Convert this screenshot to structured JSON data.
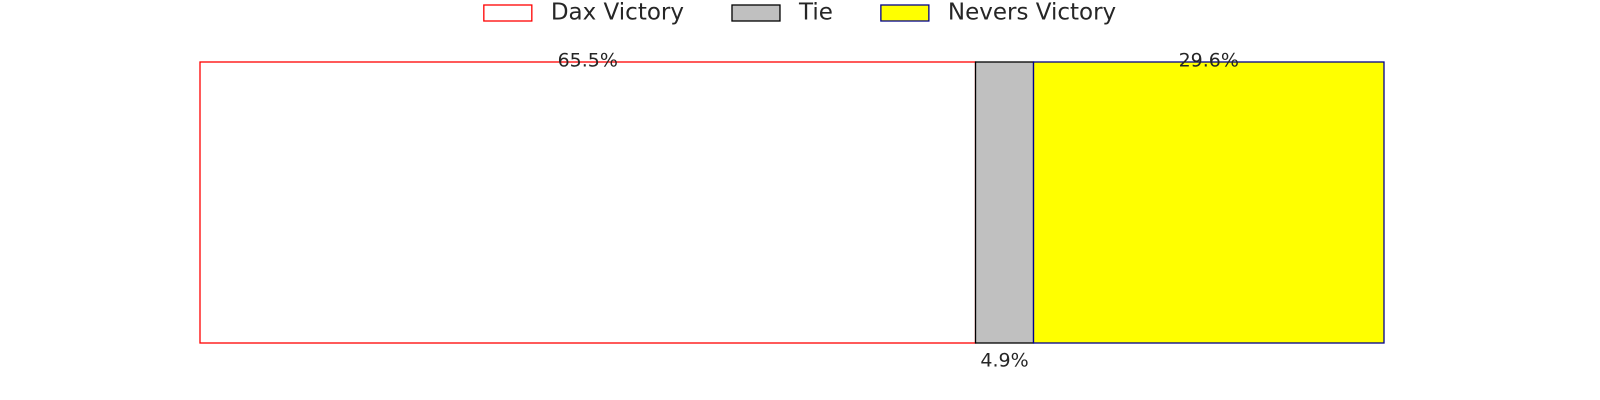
{
  "chart_data": {
    "type": "bar",
    "orientation": "horizontal",
    "stacked": true,
    "title": "",
    "xlabel": "",
    "ylabel": "",
    "grid": false,
    "legend_placement": "top-center",
    "xlim": [
      0,
      100
    ],
    "categories": [
      ""
    ],
    "series": [
      {
        "name": "Dax Victory",
        "values": [
          65.5
        ],
        "label": "65.5%",
        "label_position": "above",
        "fill": "#ffffff",
        "stroke": "#ff0000"
      },
      {
        "name": "Tie",
        "values": [
          4.9
        ],
        "label": "4.9%",
        "label_position": "below",
        "fill": "#c0c0c0",
        "stroke": "#000000"
      },
      {
        "name": "Nevers Victory",
        "values": [
          29.6
        ],
        "label": "29.6%",
        "label_position": "above",
        "fill": "#ffff00",
        "stroke": "#00008b"
      }
    ]
  }
}
